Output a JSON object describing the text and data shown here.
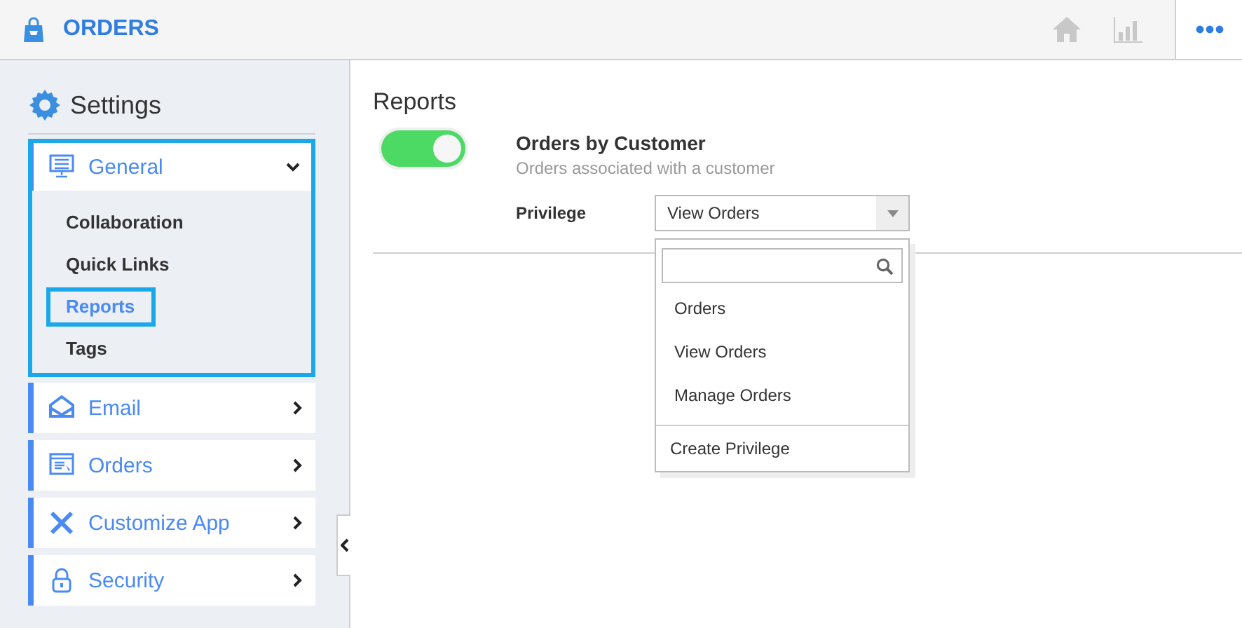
{
  "app": {
    "title": "ORDERS"
  },
  "sidebar": {
    "title": "Settings",
    "sections": [
      {
        "label": "General",
        "expanded": true,
        "highlighted": true,
        "children": [
          {
            "label": "Collaboration",
            "selected": false
          },
          {
            "label": "Quick Links",
            "selected": false
          },
          {
            "label": "Reports",
            "selected": true
          },
          {
            "label": "Tags",
            "selected": false
          }
        ]
      },
      {
        "label": "Email",
        "expanded": false,
        "highlighted": false
      },
      {
        "label": "Orders",
        "expanded": false,
        "highlighted": false
      },
      {
        "label": "Customize App",
        "expanded": false,
        "highlighted": false
      },
      {
        "label": "Security",
        "expanded": false,
        "highlighted": false
      }
    ]
  },
  "main": {
    "title": "Reports",
    "reports": [
      {
        "name": "Orders by Customer",
        "description": "Orders associated with a customer",
        "enabled": true,
        "privilege_label": "Privilege",
        "privilege": "View Orders",
        "dropdown_open": true,
        "options": [
          "Orders",
          "View Orders",
          "Manage Orders"
        ],
        "footer_action": "Create Privilege"
      }
    ]
  }
}
